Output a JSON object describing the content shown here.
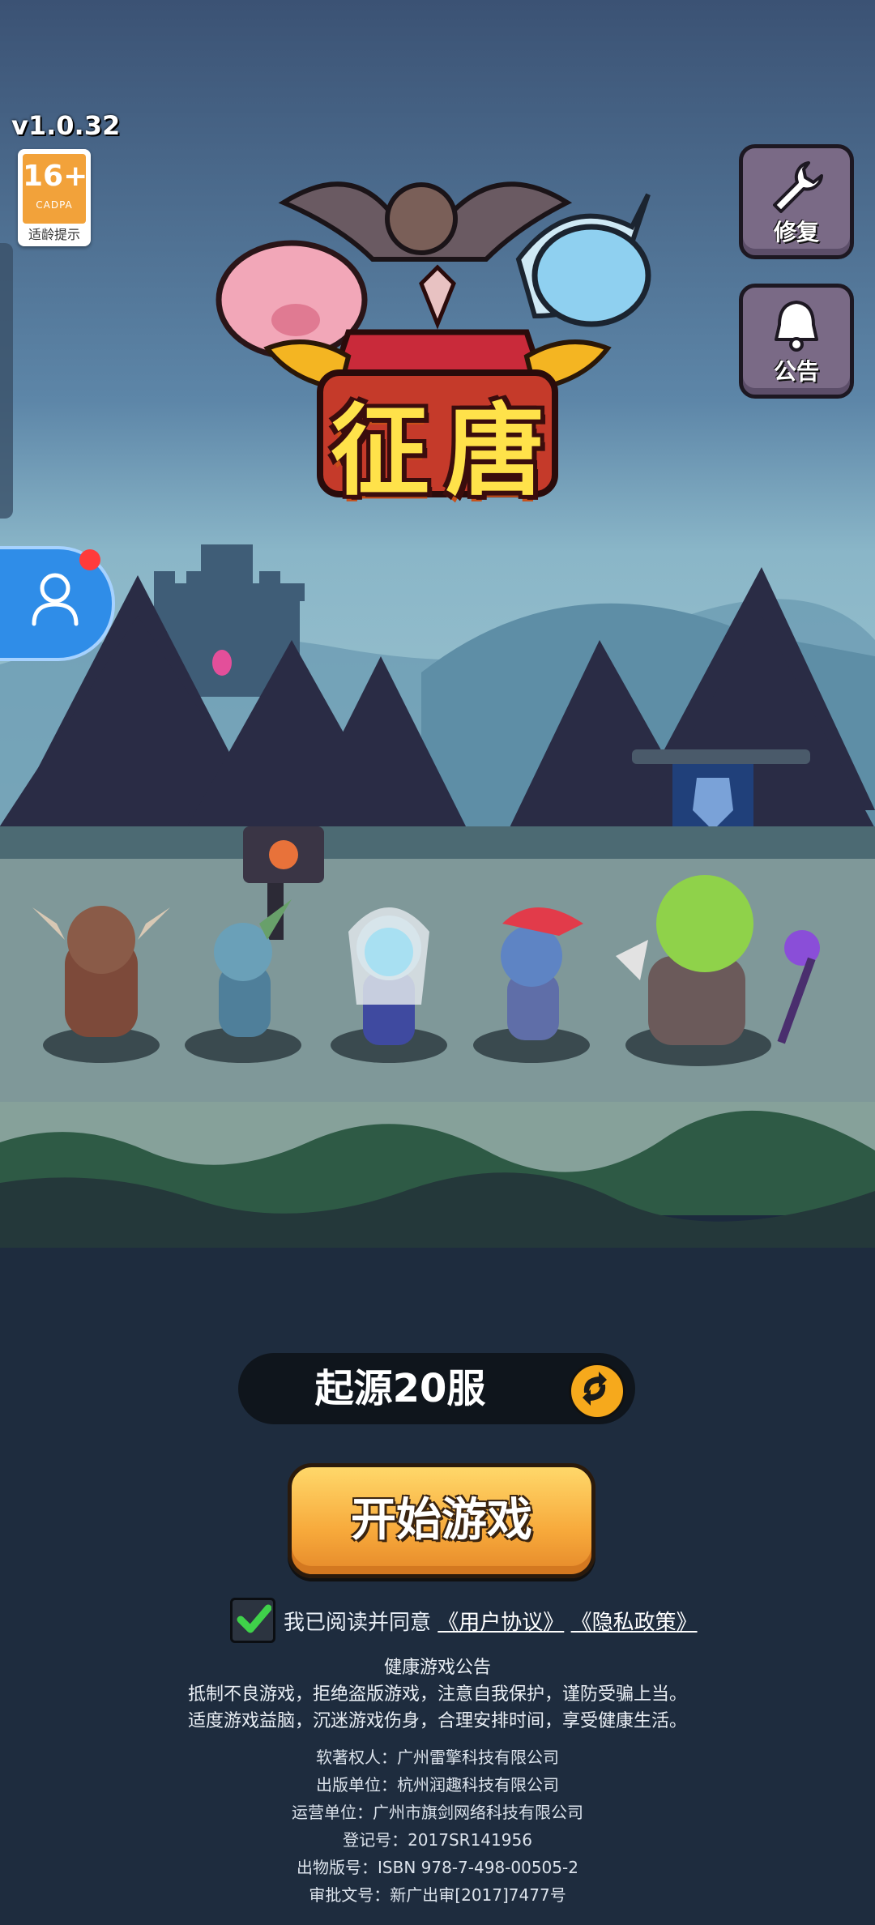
{
  "version": "v1.0.32",
  "age_rating": {
    "number": "16+",
    "org": "CADPA",
    "tip": "适龄提示"
  },
  "buttons": {
    "repair": "修复",
    "notice": "公告"
  },
  "logo": {
    "title_1": "征",
    "title_2": "唐"
  },
  "server": {
    "name": "起源20服"
  },
  "start_button": "开始游戏",
  "agreement": {
    "prefix": "我已阅读并同意",
    "user_agreement": "《用户协议》",
    "privacy_policy": "《隐私政策》",
    "checked": true
  },
  "health_notice": {
    "title": "健康游戏公告",
    "line1": "抵制不良游戏，拒绝盗版游戏，注意自我保护，谨防受骗上当。",
    "line2": "适度游戏益脑，沉迷游戏伤身，合理安排时间，享受健康生活。"
  },
  "credits": {
    "copyright": "软著权人：广州雷擎科技有限公司",
    "publisher": "出版单位：杭州润趣科技有限公司",
    "operator": "运营单位：广州市旗剑网络科技有限公司",
    "registration": "登记号：2017SR141956",
    "isbn": "出物版号：ISBN 978-7-498-00505-2",
    "approval": "审批文号：新广出审[2017]7477号"
  },
  "colors": {
    "accent": "#f7a93b",
    "avatar": "#2f8de8",
    "notification_dot": "#ff3b3b",
    "button_purple": "#7a6a86"
  },
  "icons": [
    "wrench-icon",
    "bell-icon",
    "user-icon",
    "swap-icon",
    "check-icon"
  ]
}
